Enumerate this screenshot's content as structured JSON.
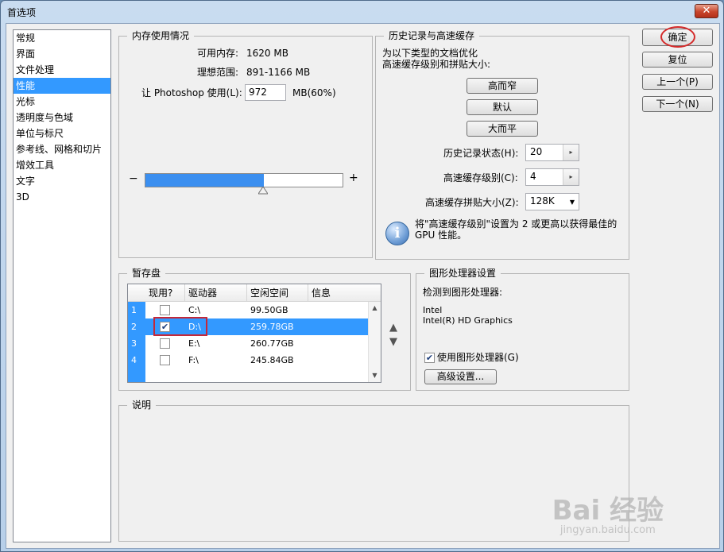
{
  "window": {
    "title": "首选项",
    "close_glyph": "✕"
  },
  "sidebar": {
    "items": [
      {
        "label": "常规"
      },
      {
        "label": "界面"
      },
      {
        "label": "文件处理"
      },
      {
        "label": "性能"
      },
      {
        "label": "光标"
      },
      {
        "label": "透明度与色域"
      },
      {
        "label": "单位与标尺"
      },
      {
        "label": "参考线、网格和切片"
      },
      {
        "label": "增效工具"
      },
      {
        "label": "文字"
      },
      {
        "label": "3D"
      }
    ],
    "selected": "性能"
  },
  "memory": {
    "title": "内存使用情况",
    "available_label": "可用内存:",
    "available_value": "1620 MB",
    "ideal_label": "理想范围:",
    "ideal_value": "891-1166 MB",
    "let_label": "让 Photoshop 使用(L):",
    "let_value": "972",
    "let_suffix": "MB(60%)",
    "minus": "−",
    "plus": "+",
    "slider_fraction": 0.6
  },
  "history": {
    "title": "历史记录与高速缓存",
    "desc_line1": "为以下类型的文档优化",
    "desc_line2": "高速缓存级别和拼贴大小:",
    "btn_tall_thin": "高而窄",
    "btn_default": "默认",
    "btn_big_flat": "大而平",
    "states_label": "历史记录状态(H):",
    "states_value": "20",
    "cache_levels_label": "高速缓存级别(C):",
    "cache_levels_value": "4",
    "tile_size_label": "高速缓存拼贴大小(Z):",
    "tile_size_value": "128K",
    "info_line1": "将\"高速缓存级别\"设置为 2 或更高以获得最佳的",
    "info_line2": "GPU 性能。",
    "spin_glyph": "▸",
    "dropdown_glyph": "▼",
    "info_glyph": "i"
  },
  "scratch": {
    "title": "暂存盘",
    "columns": {
      "active": "现用?",
      "drive": "驱动器",
      "free": "空闲空间",
      "info": "信息"
    },
    "rows": [
      {
        "num": "1",
        "checked": false,
        "drive": "C:\\",
        "free": "99.50GB",
        "info": ""
      },
      {
        "num": "2",
        "checked": true,
        "drive": "D:\\",
        "free": "259.78GB",
        "info": ""
      },
      {
        "num": "3",
        "checked": false,
        "drive": "E:\\",
        "free": "260.77GB",
        "info": ""
      },
      {
        "num": "4",
        "checked": false,
        "drive": "F:\\",
        "free": "245.84GB",
        "info": ""
      }
    ],
    "check_glyph": "✔",
    "up_glyph": "▲",
    "down_glyph": "▼"
  },
  "gpu": {
    "title": "图形处理器设置",
    "detected_label": "检测到图形处理器:",
    "vendor": "Intel",
    "model": "Intel(R) HD Graphics",
    "use_gpu_label": "使用图形处理器(G)",
    "use_gpu_checked": true,
    "advanced_button": "高级设置..."
  },
  "description": {
    "title": "说明"
  },
  "buttons": {
    "ok": "确定",
    "reset": "复位",
    "prev": "上一个(P)",
    "next": "下一个(N)"
  },
  "watermark": {
    "main": "Bai 经验",
    "sub": "jingyan.baidu.com"
  },
  "colors": {
    "selection": "#3399ff",
    "slider_fill": "#3b8ff0",
    "highlight": "#c3283a"
  }
}
